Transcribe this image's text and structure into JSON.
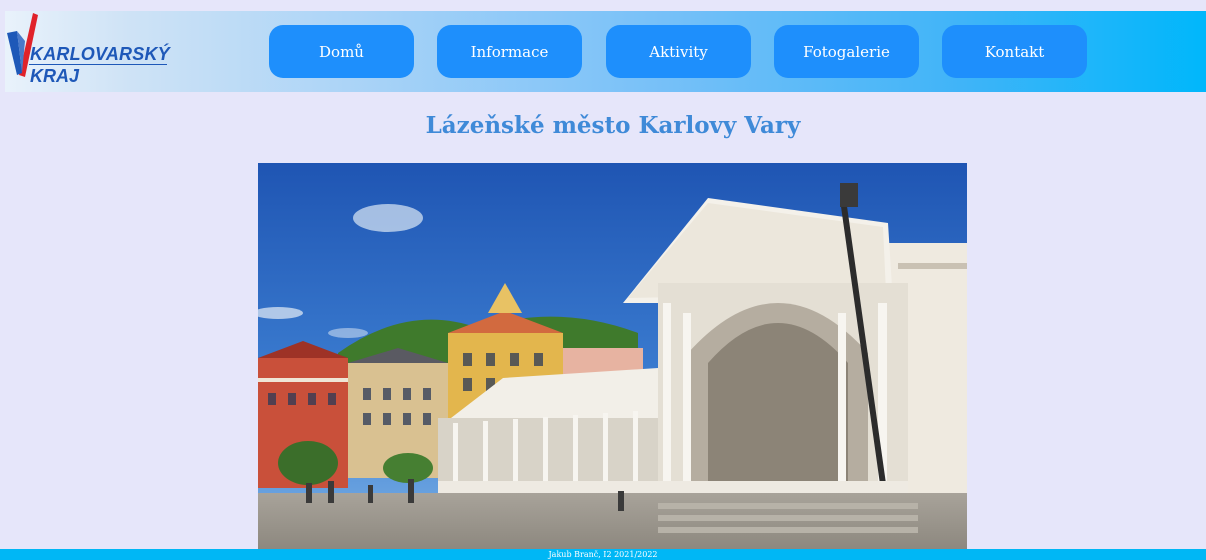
{
  "logo": {
    "line1": "KARLOVARSKÝ",
    "line2": "KRAJ"
  },
  "nav": {
    "items": [
      {
        "label": "Domů"
      },
      {
        "label": "Informace"
      },
      {
        "label": "Aktivity"
      },
      {
        "label": "Fotogalerie"
      },
      {
        "label": "Kontakt"
      }
    ]
  },
  "main": {
    "title": "Lázeňské město Karlovy Vary"
  },
  "footer": {
    "text": "Jakub Branč, I2 2021/2022"
  },
  "colors": {
    "background": "#e6e6fa",
    "nav_button": "#1e8ffc",
    "title": "#3f8ad8",
    "footer": "#00b7f5",
    "logo_red": "#e0222a",
    "logo_blue": "#1e58b8"
  }
}
